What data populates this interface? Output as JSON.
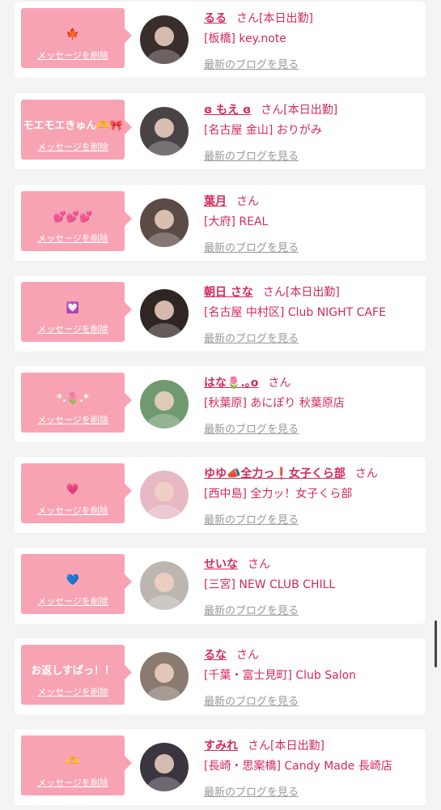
{
  "labels": {
    "delete_message": "メッセージを削除",
    "honorific": "さん",
    "latest_blog": "最新のブログを見る"
  },
  "cards": [
    {
      "message": "🍁",
      "name": "るる",
      "status": "[本日出勤]",
      "shop": "[板橋] key.note",
      "avatar_color": "#3a2e2c"
    },
    {
      "message": "モエモエきゅん🫶🎀",
      "name": "ɞ もえ ɞ",
      "status": "[本日出勤]",
      "shop": "[名古屋 金山] おりがみ",
      "avatar_color": "#4a4346"
    },
    {
      "message": "💕💕💕",
      "name": "葉月",
      "status": "",
      "shop": "[大府] REAL",
      "avatar_color": "#5b4a46"
    },
    {
      "message": "💟",
      "name": "朝日 さな",
      "status": "[本日出勤]",
      "shop": "[名古屋 中村区] Club NIGHT CAFE",
      "avatar_color": "#2f2623"
    },
    {
      "message": "*.🌷.*",
      "name": "はな🌷.｡o",
      "status": "",
      "shop": "[秋葉原] あにぽり 秋葉原店",
      "avatar_color": "#6f9a6f"
    },
    {
      "message": "💗",
      "name": "ゆゆ📣全力っ❗️女子くら部",
      "status": "",
      "shop": "[西中島] 全力ッ！女子くら部",
      "avatar_color": "#e7b9c4"
    },
    {
      "message": "💙",
      "name": "せいな",
      "status": "",
      "shop": "[三宮] NEW CLUB CHILL",
      "avatar_color": "#bdb6b0"
    },
    {
      "message": "お返しすぱっ！！",
      "name": "るな",
      "status": "",
      "shop": "[千葉・富士見町] Club Salon",
      "avatar_color": "#8a7a70"
    },
    {
      "message": "🫶",
      "name": "すみれ",
      "status": "[本日出勤]",
      "shop": "[長崎・思案橋] Candy Made 長崎店",
      "avatar_color": "#3b3540"
    }
  ]
}
